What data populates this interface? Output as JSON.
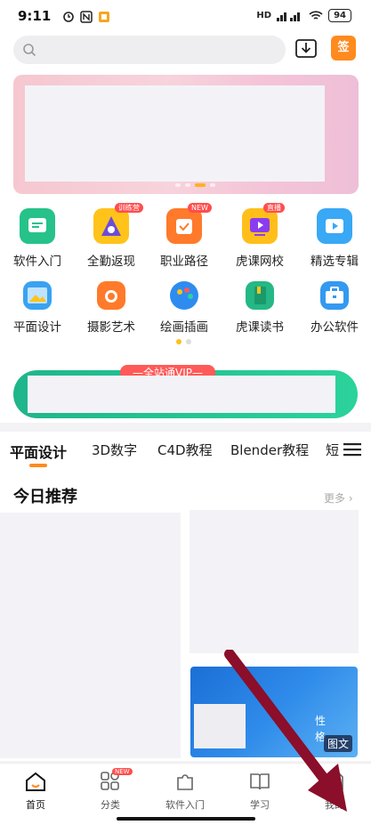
{
  "status": {
    "time": "9:11",
    "signal": "HD",
    "battery": "94"
  },
  "header": {
    "search_placeholder": "",
    "sign_label": "签"
  },
  "categories_row1": [
    {
      "label": "软件入门",
      "badge": "",
      "color": "#26c28a"
    },
    {
      "label": "全勤返现",
      "badge": "训练营",
      "color": "#ffc31a"
    },
    {
      "label": "职业路径",
      "badge": "NEW",
      "color": "#ff7a2a"
    },
    {
      "label": "虎课网校",
      "badge": "直播",
      "color": "#ffbe1a"
    },
    {
      "label": "精选专辑",
      "badge": "",
      "color": "#39a8f5"
    }
  ],
  "categories_row2": [
    {
      "label": "平面设计",
      "color": "#3aa2f0"
    },
    {
      "label": "摄影艺术",
      "color": "#ff7a2a"
    },
    {
      "label": "绘画插画",
      "color": "#2e8cf0"
    },
    {
      "label": "虎课读书",
      "color": "#25b884"
    },
    {
      "label": "办公软件",
      "color": "#3499f0"
    }
  ],
  "vip": {
    "tag": "—全站通VIP—"
  },
  "tabs": [
    "平面设计",
    "3D数字",
    "C4D教程",
    "Blender教程",
    "短"
  ],
  "today": {
    "title": "今日推荐",
    "more": "更多 ›",
    "card3_text1": "性",
    "card3_text2": "格",
    "card3_tag": "图文"
  },
  "bottom_nav": [
    {
      "label": "首页",
      "badge": ""
    },
    {
      "label": "分类",
      "badge": "NEW"
    },
    {
      "label": "软件入门",
      "badge": ""
    },
    {
      "label": "学习",
      "badge": ""
    },
    {
      "label": "我的",
      "badge": ""
    }
  ],
  "colors": {
    "accent": "#ff8a1e",
    "vip_green": "#1fb58b",
    "arrow": "#8b0e2a"
  }
}
